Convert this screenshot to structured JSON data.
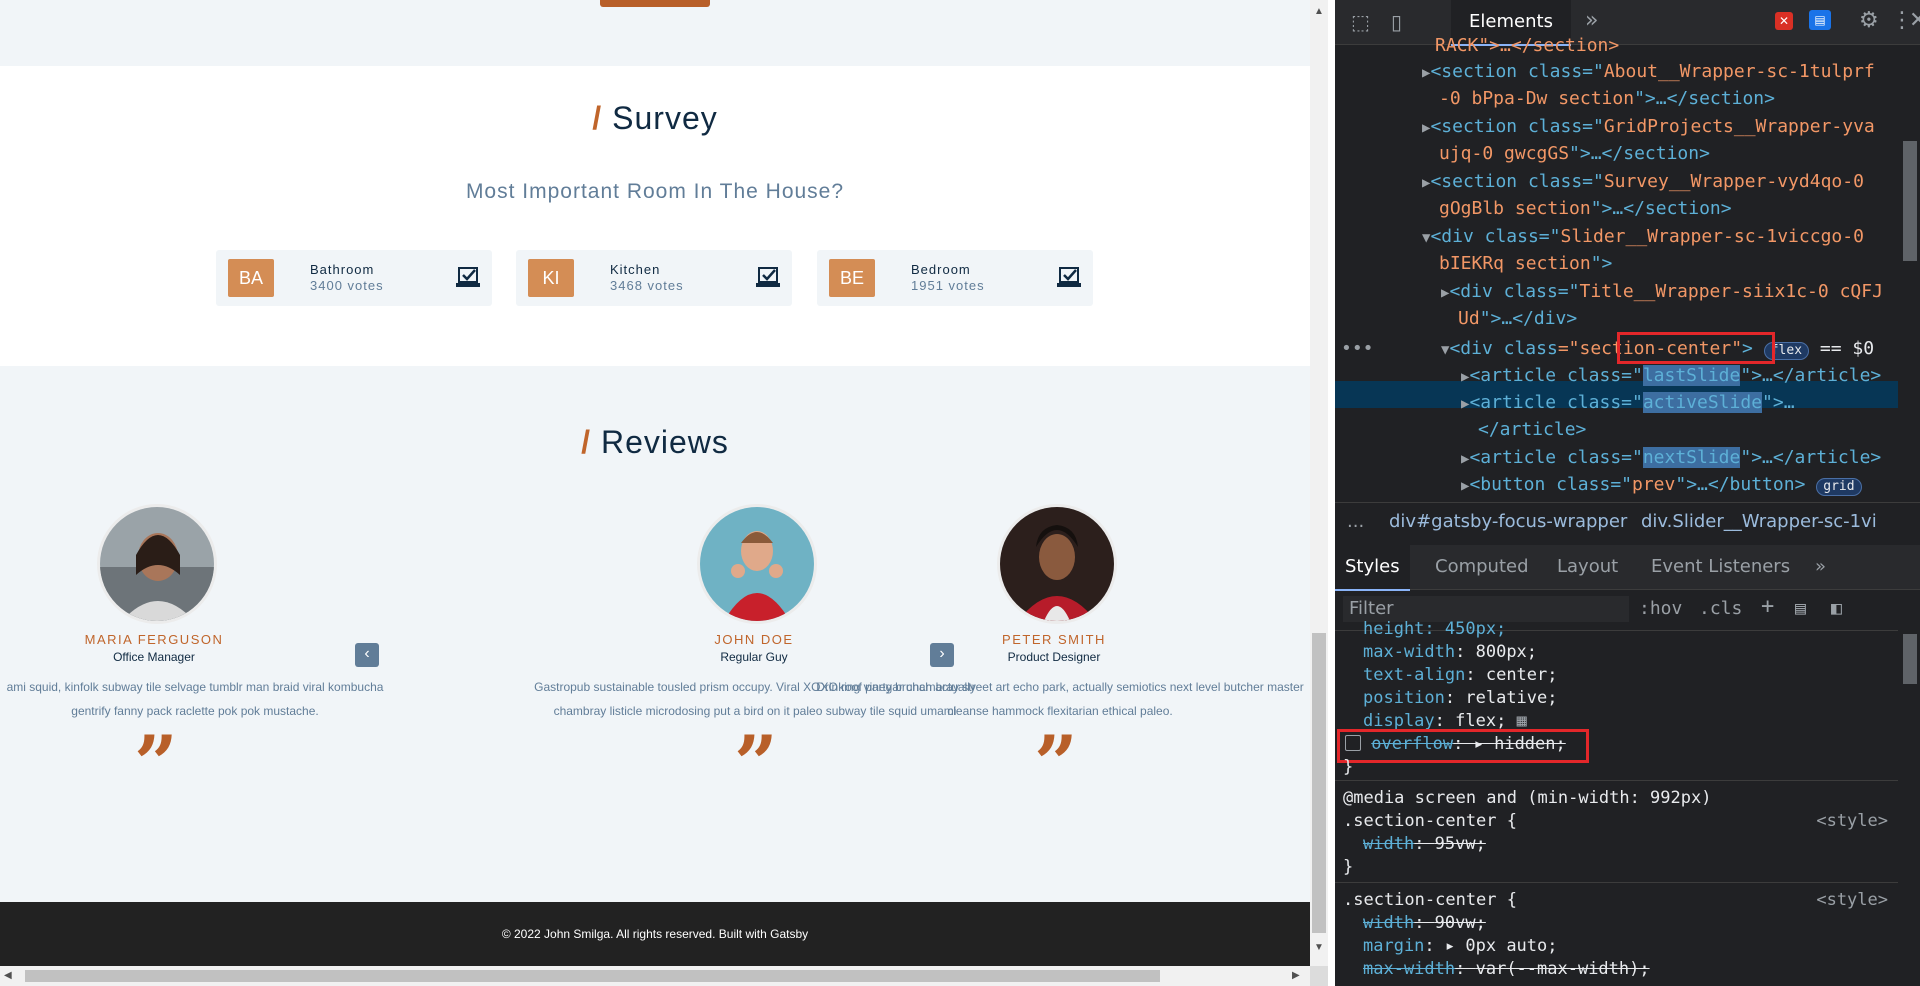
{
  "survey": {
    "title": "Survey",
    "slash": "/",
    "subtitle": "Most Important Room In The House?",
    "items": [
      {
        "abbr": "BA",
        "name": "Bathroom",
        "votes": "3400 votes"
      },
      {
        "abbr": "KI",
        "name": "Kitchen",
        "votes": "3468 votes"
      },
      {
        "abbr": "BE",
        "name": "Bedroom",
        "votes": "1951 votes"
      }
    ]
  },
  "reviews": {
    "title": "Reviews",
    "slash": "/",
    "people": [
      {
        "name": "MARIA FERGUSON",
        "job": "Office Manager",
        "text1": "ami squid, kinfolk subway tile selvage tumblr man braid viral kombucha",
        "text2": "gentrify fanny pack raclette pok pok mustache."
      },
      {
        "name": "JOHN DOE",
        "job": "Regular Guy",
        "text1": "Gastropub sustainable tousled prism occupy. Viral XOXO roof party brunch actually",
        "text2": "chambray listicle microdosing put a bird on it paleo subway tile squid umami"
      },
      {
        "name": "PETER SMITH",
        "job": "Product Designer",
        "text1": "Drinking vinegar chambray street art echo park, actually semiotics next level butcher master",
        "text2": "cleanse hammock flexitarian ethical paleo."
      }
    ],
    "quote_glyph": "”",
    "prev_label": "‹",
    "next_label": "›"
  },
  "footer": {
    "text": "© 2022 John Smilga. All rights reserved. Built with Gatsby"
  },
  "devtools": {
    "active_tab": "Elements",
    "more_tabs": "»",
    "dom_lines": [
      {
        "t": "RACK\">…</section>"
      },
      {
        "t1": "<section class=\"",
        "v": "About__Wrapper-sc-1tulprf",
        "t2": ""
      },
      {
        "t1": "-0 bPpa-Dw section",
        "t2": "\">…</section>"
      },
      {
        "t1": "<section class=\"",
        "v": "GridProjects__Wrapper-yva",
        "t2": ""
      },
      {
        "t1": "ujq-0 gwcgGS",
        "t2": "\">…</section>"
      },
      {
        "t1": "<section class=\"",
        "v": "Survey__Wrapper-vyd4qo-0",
        "t2": ""
      },
      {
        "t1": "gOgBlb section",
        "t2": "\">…</section>"
      },
      {
        "t1": "<div class=\"",
        "v": "Slider__Wrapper-sc-1viccgo-0",
        "t2": ""
      },
      {
        "t1": "bIEKRq section",
        "t2": "\">"
      },
      {
        "t1": "<div class=\"",
        "v": "Title__Wrapper-siix1c-0 cQFJ",
        "t2": ""
      },
      {
        "t1": "Ud",
        "t2": "\">…</div>"
      },
      {
        "t1": "<div class",
        "v": "=\"section-center\"",
        "t2": ">"
      },
      {
        "t1": "<article class=\"",
        "v": "lastSlide",
        "t2": "\">…</article>"
      },
      {
        "t1": "<article class=\"",
        "v": "activeSlide",
        "t2": "\">…"
      },
      {
        "t1": "</article>"
      },
      {
        "t1": "<article class=\"",
        "v": "nextSlide",
        "t2": "\">…</article>"
      },
      {
        "t1": "<button class=\"",
        "v": "prev",
        "t2": "\">…</button>"
      }
    ],
    "flex_badge": "flex",
    "dollar0": "== $0",
    "grid_badge": "grid",
    "crumbs": [
      "...",
      "div#gatsby-focus-wrapper",
      "div.Slider__Wrapper-sc-1vi"
    ],
    "subtabs": [
      "Styles",
      "Computed",
      "Layout",
      "Event Listeners",
      "»"
    ],
    "filter_placeholder": "Filter",
    "hov": ":hov",
    "cls": ".cls",
    "css": {
      "l1": "height: 450px;",
      "l2p": "max-width",
      "l2v": "800px;",
      "l3p": "text-align",
      "l3v": "center;",
      "l4p": "position",
      "l4v": "relative;",
      "l5p": "display",
      "l5v": "flex;",
      "l6p": "overflow",
      "l6v": "hidden;",
      "close": "}",
      "media": "@media screen and (min-width: 992px)",
      "sel1": ".section-center {",
      "style_src": "<style>",
      "w1p": "width",
      "w1v": "95vw;",
      "sel2": ".section-center {",
      "w2p": "width",
      "w2v": "90vw;",
      "mp": "margin",
      "mv": "0px auto;",
      "maxp": "max-width",
      "maxv": "var(--max-width);"
    }
  }
}
